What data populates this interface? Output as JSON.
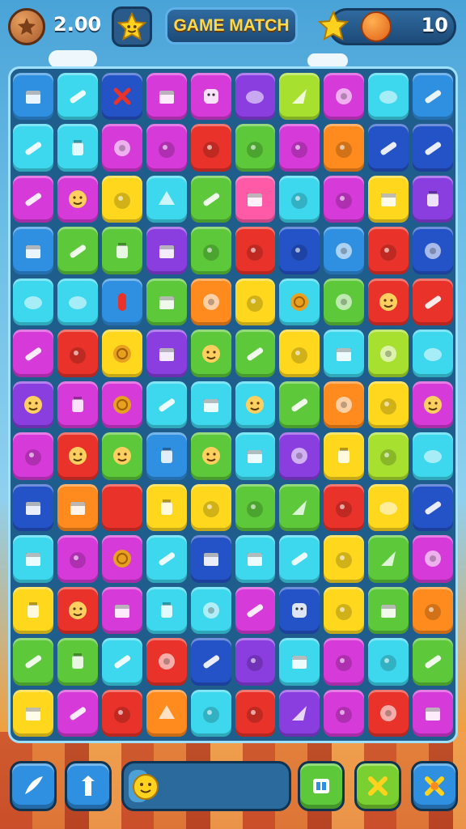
{
  "hud": {
    "score": "2.00",
    "title": "GAME MATCH",
    "coins": "10"
  },
  "colors": {
    "blue": "#2f8fe0",
    "cyan": "#3dd8ee",
    "magenta": "#d63ad8",
    "purple": "#8a3ee0",
    "green": "#5cc83a",
    "lime": "#a8e030",
    "yellow": "#ffd81e",
    "orange": "#ff8a1e",
    "red": "#e8322a",
    "pink": "#ff5aa8",
    "navy": "#2453c8",
    "teal": "#2ec8b0"
  },
  "board": {
    "columns": 10,
    "rows": [
      [
        [
          "blue",
          "box"
        ],
        [
          "cyan",
          "pencil"
        ],
        [
          "navy",
          "x"
        ],
        [
          "magenta",
          "box"
        ],
        [
          "magenta",
          "square"
        ],
        [
          "purple",
          "blob"
        ],
        [
          "lime",
          "cone"
        ],
        [
          "magenta",
          "flower"
        ],
        [
          "cyan",
          "blob"
        ],
        [
          "blue",
          "pencil"
        ]
      ],
      [
        [
          "cyan",
          "pencil"
        ],
        [
          "cyan",
          "jar"
        ],
        [
          "magenta",
          "flower"
        ],
        [
          "magenta",
          "fruit"
        ],
        [
          "red",
          "fruit"
        ],
        [
          "green",
          "fruit"
        ],
        [
          "magenta",
          "fruit"
        ],
        [
          "orange",
          "fruit"
        ],
        [
          "navy",
          "pencil"
        ],
        [
          "navy",
          "pencil"
        ]
      ],
      [
        [
          "magenta",
          "pencil"
        ],
        [
          "magenta",
          "face"
        ],
        [
          "yellow",
          "fruit"
        ],
        [
          "cyan",
          "shell"
        ],
        [
          "green",
          "pencil"
        ],
        [
          "pink",
          "box"
        ],
        [
          "cyan",
          "fruit"
        ],
        [
          "magenta",
          "fruit"
        ],
        [
          "yellow",
          "box"
        ],
        [
          "purple",
          "jar"
        ]
      ],
      [
        [
          "blue",
          "box"
        ],
        [
          "green",
          "pencil"
        ],
        [
          "green",
          "jar"
        ],
        [
          "purple",
          "box"
        ],
        [
          "green",
          "fruit"
        ],
        [
          "red",
          "fruit"
        ],
        [
          "navy",
          "fruit"
        ],
        [
          "blue",
          "flower"
        ],
        [
          "red",
          "fruit"
        ],
        [
          "navy",
          "flower"
        ]
      ],
      [
        [
          "cyan",
          "blob"
        ],
        [
          "cyan",
          "blob"
        ],
        [
          "blue",
          "pill"
        ],
        [
          "green",
          "box"
        ],
        [
          "orange",
          "flower"
        ],
        [
          "yellow",
          "fruit"
        ],
        [
          "cyan",
          "coin"
        ],
        [
          "green",
          "flower"
        ],
        [
          "red",
          "face"
        ],
        [
          "red",
          "pencil"
        ]
      ],
      [
        [
          "magenta",
          "pencil"
        ],
        [
          "red",
          "fruit"
        ],
        [
          "yellow",
          "coin"
        ],
        [
          "purple",
          "box"
        ],
        [
          "green",
          "face"
        ],
        [
          "green",
          "pencil"
        ],
        [
          "yellow",
          "fruit"
        ],
        [
          "cyan",
          "box"
        ],
        [
          "lime",
          "flower"
        ],
        [
          "cyan",
          "blob"
        ]
      ],
      [
        [
          "purple",
          "face"
        ],
        [
          "magenta",
          "jar"
        ],
        [
          "magenta",
          "coin"
        ],
        [
          "cyan",
          "pencil"
        ],
        [
          "cyan",
          "box"
        ],
        [
          "cyan",
          "face"
        ],
        [
          "green",
          "pencil"
        ],
        [
          "orange",
          "flower"
        ],
        [
          "yellow",
          "fruit"
        ],
        [
          "magenta",
          "face"
        ]
      ],
      [
        [
          "magenta",
          "fruit"
        ],
        [
          "red",
          "face"
        ],
        [
          "green",
          "face"
        ],
        [
          "blue",
          "jar"
        ],
        [
          "green",
          "face"
        ],
        [
          "cyan",
          "box"
        ],
        [
          "purple",
          "flower"
        ],
        [
          "yellow",
          "jar"
        ],
        [
          "lime",
          "fruit"
        ],
        [
          "cyan",
          "blob"
        ]
      ],
      [
        [
          "navy",
          "box"
        ],
        [
          "orange",
          "box"
        ],
        [
          "red",
          "pill"
        ],
        [
          "yellow",
          "jar"
        ],
        [
          "yellow",
          "fruit"
        ],
        [
          "green",
          "fruit"
        ],
        [
          "green",
          "cone"
        ],
        [
          "red",
          "fruit"
        ],
        [
          "yellow",
          "blob"
        ],
        [
          "navy",
          "pencil"
        ]
      ],
      [
        [
          "cyan",
          "box"
        ],
        [
          "magenta",
          "fruit"
        ],
        [
          "magenta",
          "coin"
        ],
        [
          "cyan",
          "pencil"
        ],
        [
          "navy",
          "box"
        ],
        [
          "cyan",
          "box"
        ],
        [
          "cyan",
          "pencil"
        ],
        [
          "yellow",
          "fruit"
        ],
        [
          "green",
          "cone"
        ],
        [
          "magenta",
          "flower"
        ]
      ],
      [
        [
          "yellow",
          "jar"
        ],
        [
          "red",
          "face"
        ],
        [
          "magenta",
          "box"
        ],
        [
          "cyan",
          "jar"
        ],
        [
          "cyan",
          "flower"
        ],
        [
          "magenta",
          "pencil"
        ],
        [
          "navy",
          "square"
        ],
        [
          "yellow",
          "fruit"
        ],
        [
          "green",
          "box"
        ],
        [
          "orange",
          "fruit"
        ]
      ],
      [
        [
          "green",
          "pencil"
        ],
        [
          "green",
          "jar"
        ],
        [
          "cyan",
          "pencil"
        ],
        [
          "red",
          "flower"
        ],
        [
          "navy",
          "pencil"
        ],
        [
          "purple",
          "fruit"
        ],
        [
          "cyan",
          "box"
        ],
        [
          "magenta",
          "fruit"
        ],
        [
          "cyan",
          "fruit"
        ],
        [
          "green",
          "pencil"
        ]
      ],
      [
        [
          "yellow",
          "box"
        ],
        [
          "magenta",
          "pencil"
        ],
        [
          "red",
          "fruit"
        ],
        [
          "orange",
          "shell"
        ],
        [
          "cyan",
          "fruit"
        ],
        [
          "red",
          "fruit"
        ],
        [
          "purple",
          "cone"
        ],
        [
          "magenta",
          "fruit"
        ],
        [
          "red",
          "flower"
        ],
        [
          "magenta",
          "box"
        ]
      ]
    ]
  },
  "bottom_bar": {
    "buttons": [
      {
        "name": "feather-button",
        "icon": "feather-icon",
        "color": "#2f8fe0"
      },
      {
        "name": "arrow-button",
        "icon": "arrow-icon",
        "color": "#2f8fe0"
      },
      {
        "name": "card-button",
        "icon": "card-icon",
        "color": "#5cc83a"
      },
      {
        "name": "cross-button",
        "icon": "cross-icon",
        "color": "#7ad030"
      },
      {
        "name": "shuffle-button",
        "icon": "shuffle-icon",
        "color": "#2f8fe0"
      }
    ],
    "progress": 0.12
  }
}
